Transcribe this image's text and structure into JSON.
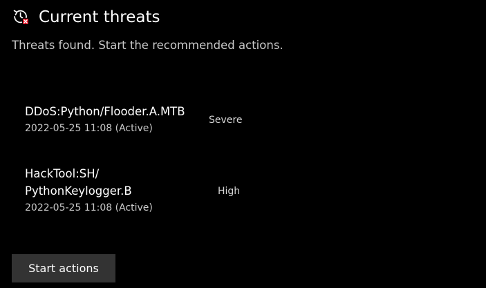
{
  "header": {
    "icon": "threat-history-icon",
    "title": "Current threats",
    "subtitle": "Threats found. Start the recommended actions."
  },
  "threats": [
    {
      "name_lines": [
        "DDoS:Python/Flooder.A.MTB"
      ],
      "date": "2022-05-25 11:08 (Active)",
      "severity": "Severe"
    },
    {
      "name_lines": [
        "HackTool:SH/",
        "PythonKeylogger.B"
      ],
      "date": "2022-05-25 11:08 (Active)",
      "severity": "High"
    }
  ],
  "actions": {
    "start_label": "Start actions"
  },
  "colors": {
    "background": "#000000",
    "text_primary": "#ffffff",
    "text_secondary": "#c9c9c9",
    "button_bg": "#333333",
    "alert_red": "#e81123"
  }
}
